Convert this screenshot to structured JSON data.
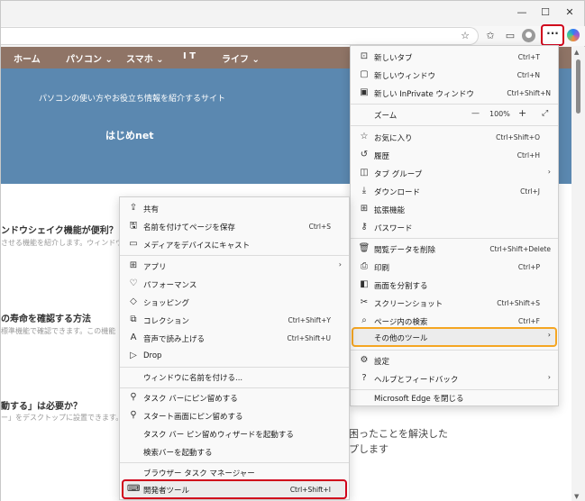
{
  "window": {
    "minimize_glyph": "—",
    "maximize_glyph": "☐",
    "close_glyph": "✕"
  },
  "toolbar": {
    "favorite_glyph": "☆",
    "collections_glyph": "✩",
    "cast_glyph": "▭",
    "more_glyph": "···"
  },
  "site": {
    "nav": [
      "ホーム",
      "パソコン ⌄",
      "スマホ ⌄",
      "I T",
      "ライフ ⌄"
    ],
    "tagline": "パソコンの使い方やお役立ち情報を紹介するサイト",
    "name": "はじめnet",
    "articles": [
      {
        "title": "ンドウシェイク機能が便利？",
        "sub": "させる機能を紹介します。ウィンドウ"
      },
      {
        "title": "の寿命を確認する方法",
        "sub": "標準機能で確認できます。この機能"
      },
      {
        "title": "動する」は必要か？",
        "sub": "ー」をデスクトップに設置できます。"
      }
    ],
    "right_text_1": "困ったことを解決した",
    "right_text_2": "プします"
  },
  "main_menu": {
    "items": [
      {
        "label": "新しいタブ",
        "shortcut": "Ctrl+T",
        "icon": "new-tab-icon"
      },
      {
        "label": "新しいウィンドウ",
        "shortcut": "Ctrl+N",
        "icon": "new-window-icon"
      },
      {
        "label": "新しい InPrivate ウィンドウ",
        "shortcut": "Ctrl+Shift+N",
        "icon": "inprivate-icon"
      },
      {
        "label": "ズーム",
        "zoom": "100%"
      },
      {
        "label": "お気に入り",
        "shortcut": "Ctrl+Shift+O",
        "icon": "favorites-icon"
      },
      {
        "label": "履歴",
        "shortcut": "Ctrl+H",
        "icon": "history-icon"
      },
      {
        "label": "タブ グループ",
        "icon": "tab-groups-icon",
        "submenu": true
      },
      {
        "label": "ダウンロード",
        "shortcut": "Ctrl+J",
        "icon": "download-icon"
      },
      {
        "label": "拡張機能",
        "icon": "extensions-icon"
      },
      {
        "label": "パスワード",
        "icon": "password-icon"
      },
      {
        "label": "閲覧データを削除",
        "shortcut": "Ctrl+Shift+Delete",
        "icon": "delete-icon"
      },
      {
        "label": "印刷",
        "shortcut": "Ctrl+P",
        "icon": "print-icon"
      },
      {
        "label": "画面を分割する",
        "icon": "split-screen-icon"
      },
      {
        "label": "スクリーンショット",
        "shortcut": "Ctrl+Shift+S",
        "icon": "screenshot-icon"
      },
      {
        "label": "ページ内の検索",
        "shortcut": "Ctrl+F",
        "icon": "find-icon"
      },
      {
        "label": "その他のツール",
        "submenu": true
      },
      {
        "label": "設定",
        "icon": "settings-icon"
      },
      {
        "label": "ヘルプとフィードバック",
        "icon": "help-icon",
        "submenu": true
      },
      {
        "label": "Microsoft Edge を閉じる"
      }
    ],
    "zoom_minus": "—",
    "zoom_plus": "+",
    "zoom_expand": "⤢"
  },
  "sub_menu": {
    "items": [
      {
        "label": "共有",
        "icon": "share-icon"
      },
      {
        "label": "名前を付けてページを保存",
        "shortcut": "Ctrl+S",
        "icon": "save-icon"
      },
      {
        "label": "メディアをデバイスにキャスト",
        "icon": "cast-icon"
      },
      {
        "label": "アプリ",
        "icon": "apps-icon",
        "submenu": true
      },
      {
        "label": "パフォーマンス",
        "icon": "performance-icon"
      },
      {
        "label": "ショッピング",
        "icon": "shopping-icon"
      },
      {
        "label": "コレクション",
        "shortcut": "Ctrl+Shift+Y",
        "icon": "collections-icon"
      },
      {
        "label": "音声で読み上げる",
        "shortcut": "Ctrl+Shift+U",
        "icon": "read-aloud-icon"
      },
      {
        "label": "Drop",
        "icon": "drop-icon"
      },
      {
        "label": "ウィンドウに名前を付ける..."
      },
      {
        "label": "タスク バーにピン留めする",
        "icon": "pin-icon"
      },
      {
        "label": "スタート画面にピン留めする",
        "icon": "pin-start-icon"
      },
      {
        "label": "タスク バー ピン留めウィザードを起動する"
      },
      {
        "label": "検索バーを起動する"
      },
      {
        "label": "ブラウザー タスク マネージャー"
      },
      {
        "label": "開発者ツール",
        "shortcut": "Ctrl+Shift+I",
        "icon": "devtools-icon"
      }
    ]
  },
  "arrow_glyph": "›"
}
